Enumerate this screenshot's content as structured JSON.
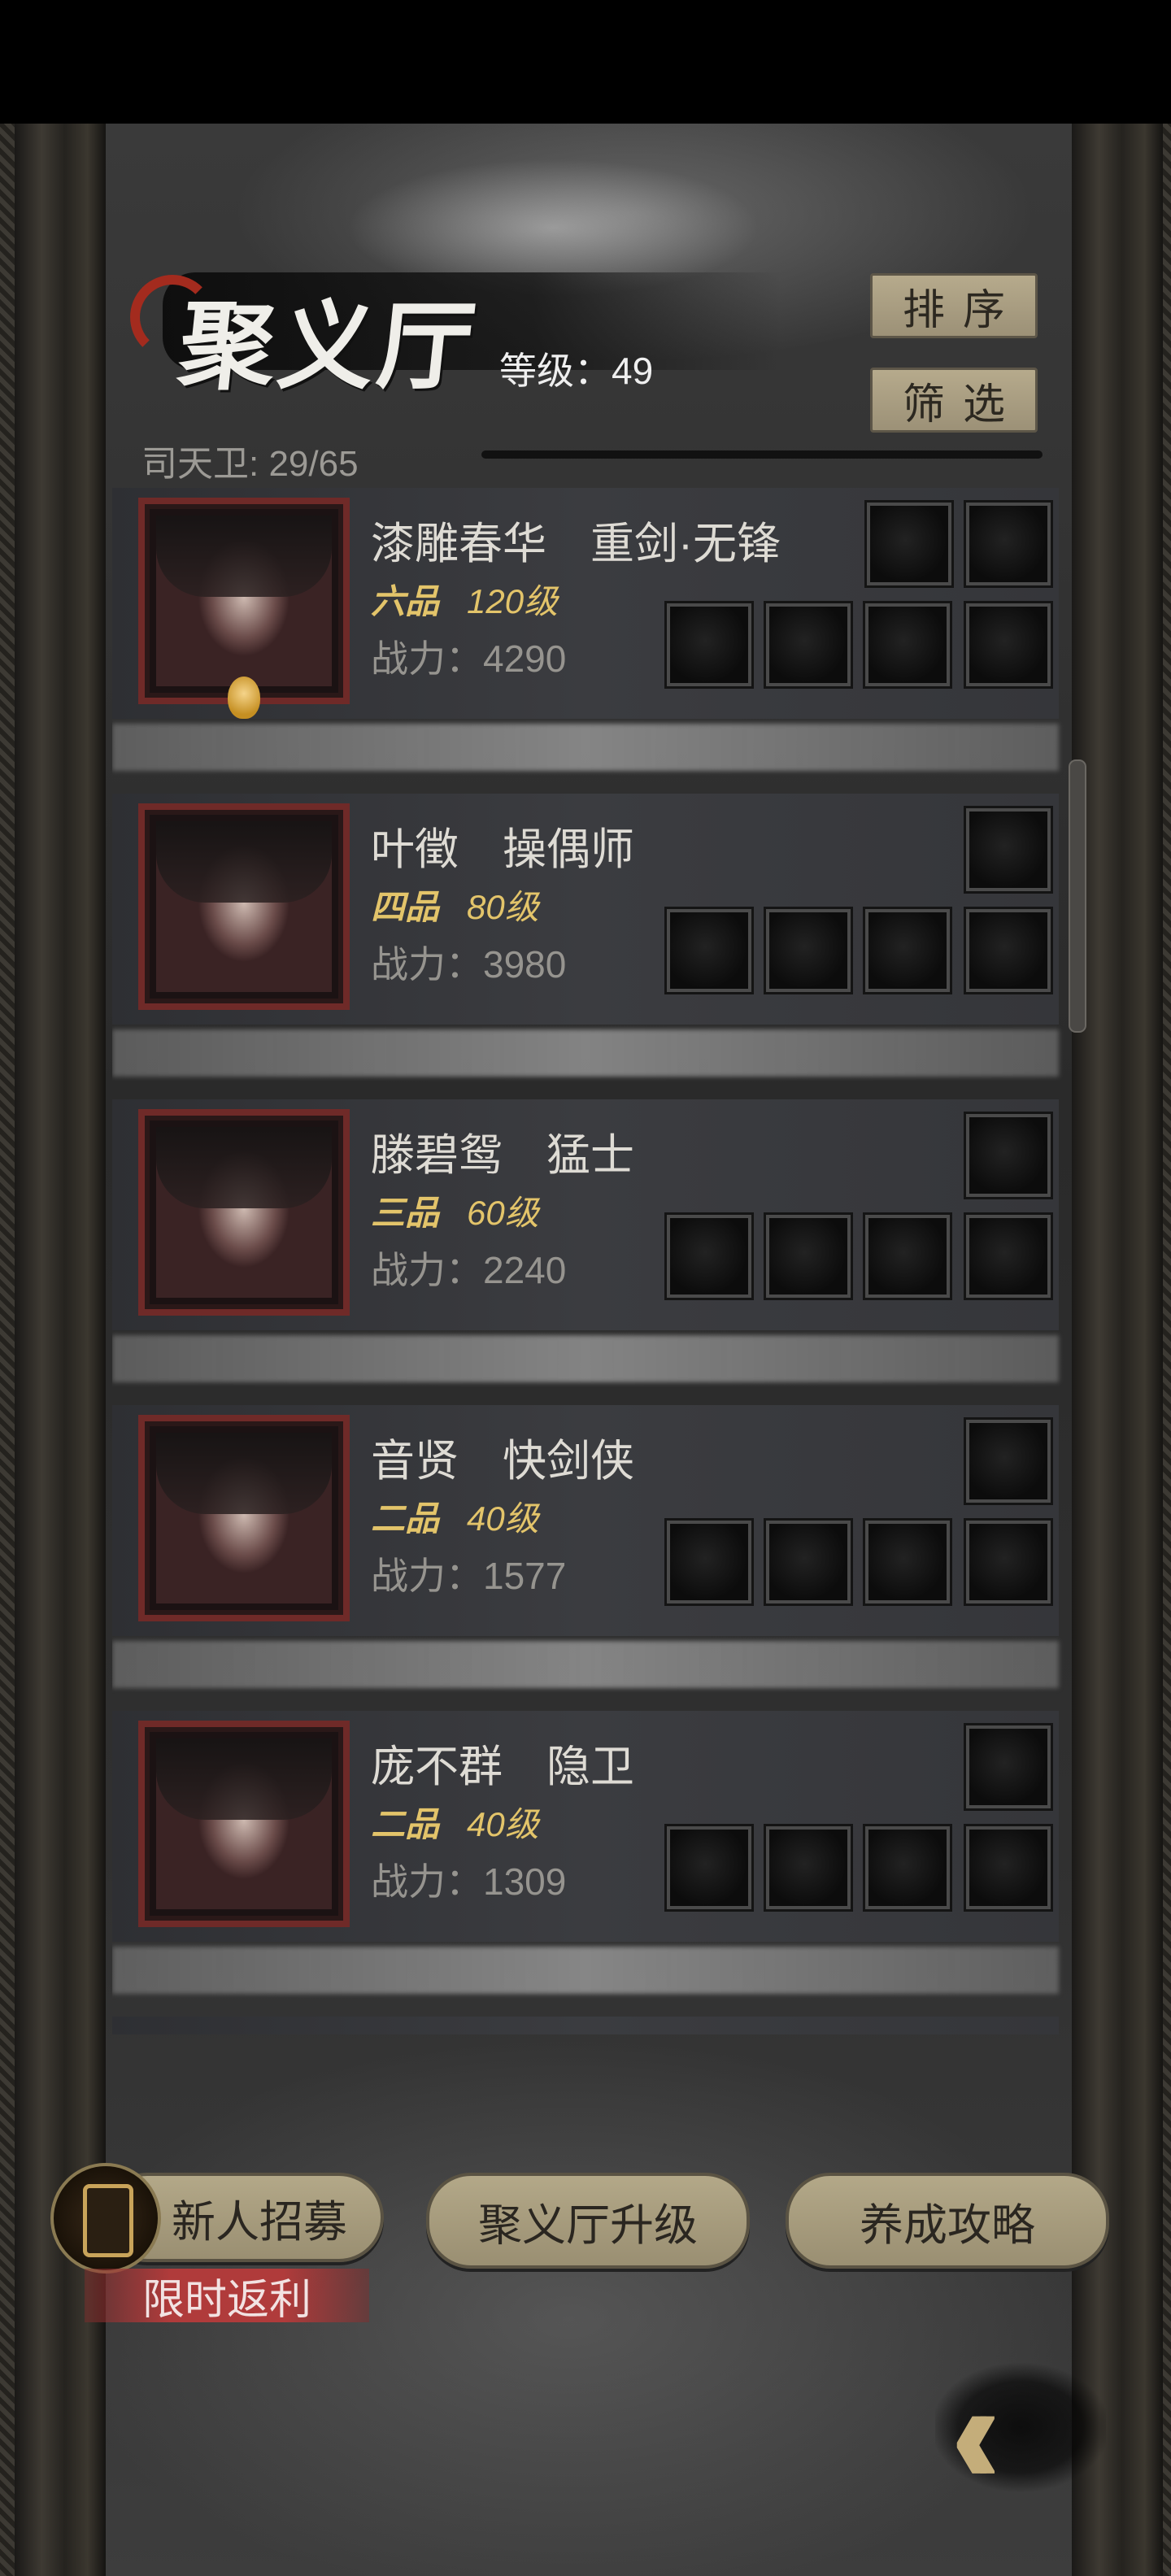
{
  "header": {
    "title": "聚义厅",
    "level_text": "等级：49",
    "guard_count": "司天卫: 29/65",
    "sort_label": "排序",
    "filter_label": "筛选"
  },
  "heroes": [
    {
      "name": "漆雕春华　重剑·无锋",
      "rank": "六品",
      "level": "120级",
      "power": "战力：4290",
      "portrait_icon": "hero-portrait-straw-hat",
      "top_slots": 2
    },
    {
      "name": "叶徵　操偶师",
      "rank": "四品",
      "level": "80级",
      "power": "战力：3980",
      "portrait_icon": "hero-portrait-cat-ears",
      "top_slots": 1
    },
    {
      "name": "滕碧鸳　猛士",
      "rank": "三品",
      "level": "60级",
      "power": "战力：2240",
      "portrait_icon": "hero-portrait-buns",
      "top_slots": 1
    },
    {
      "name": "音贤　快剑侠",
      "rank": "二品",
      "level": "40级",
      "power": "战力：1577",
      "portrait_icon": "hero-portrait-white-hair",
      "top_slots": 1
    },
    {
      "name": "庞不群　隐卫",
      "rank": "二品",
      "level": "40级",
      "power": "战力：1309",
      "portrait_icon": "hero-portrait-blindfold",
      "top_slots": 1
    }
  ],
  "actions": {
    "recruit_label": "新人招募",
    "upgrade_label": "聚义厅升级",
    "guide_label": "养成攻略",
    "promo_label": "限时返利"
  },
  "colors": {
    "accent_gold": "#e3c46a",
    "frame_red": "#6f2a28",
    "button_tan": "#b3a888",
    "promo_red": "#b03b3b"
  }
}
